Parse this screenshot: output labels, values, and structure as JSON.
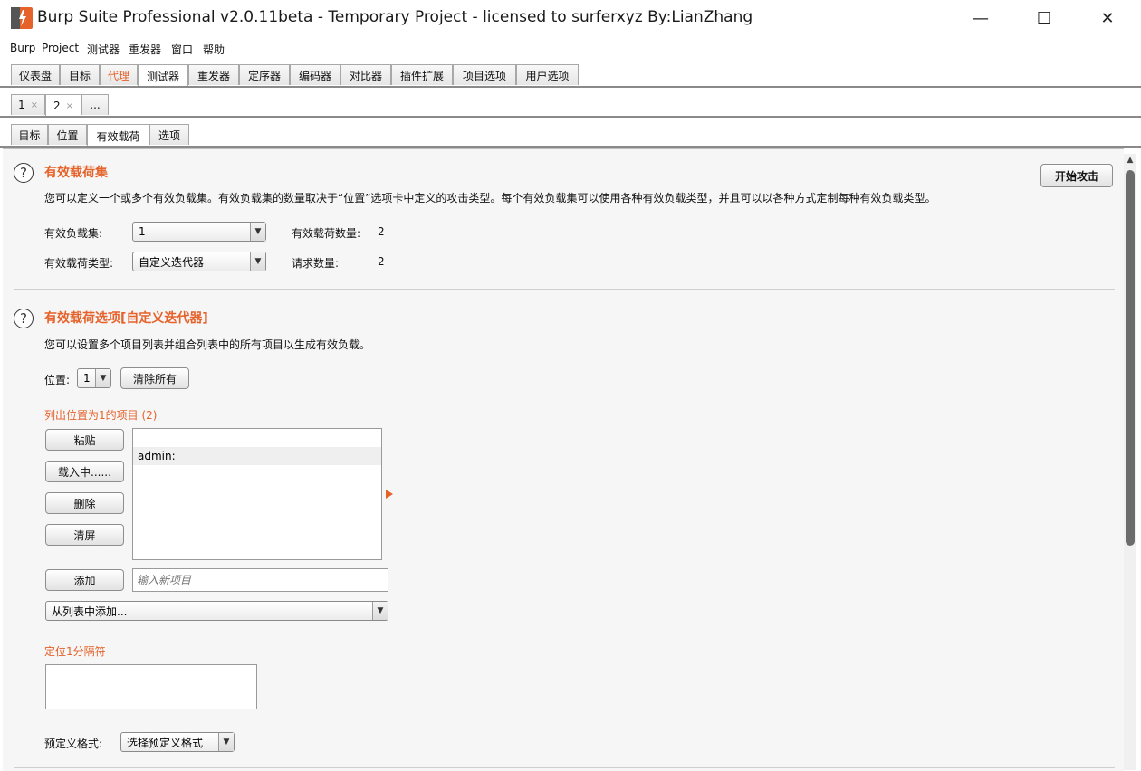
{
  "window": {
    "title": "Burp Suite Professional v2.0.11beta - Temporary Project - licensed to surferxyz By:LianZhang",
    "minimize": "—",
    "maximize": "☐",
    "close": "✕"
  },
  "menu": [
    "Burp",
    "Project",
    "测试器",
    "重发器",
    "窗口",
    "帮助"
  ],
  "main_tabs": [
    {
      "label": "仪表盘"
    },
    {
      "label": "目标"
    },
    {
      "label": "代理"
    },
    {
      "label": "测试器"
    },
    {
      "label": "重发器"
    },
    {
      "label": "定序器"
    },
    {
      "label": "编码器"
    },
    {
      "label": "对比器"
    },
    {
      "label": "插件扩展"
    },
    {
      "label": "项目选项"
    },
    {
      "label": "用户选项"
    }
  ],
  "attack_tabs": [
    {
      "label": "1",
      "close": "×"
    },
    {
      "label": "2",
      "close": "×"
    },
    {
      "label": "..."
    }
  ],
  "sub_tabs": [
    {
      "label": "目标"
    },
    {
      "label": "位置"
    },
    {
      "label": "有效载荷"
    },
    {
      "label": "选项"
    }
  ],
  "payload_sets": {
    "help": "?",
    "title": "有效载荷集",
    "description": "您可以定义一个或多个有效负载集。有效负载集的数量取决于“位置”选项卡中定义的攻击类型。每个有效负载集可以使用各种有效负载类型，并且可以以各种方式定制每种有效负载类型。",
    "start_attack": "开始攻击",
    "set_label": "有效负载集:",
    "set_value": "1",
    "count_label": "有效载荷数量:",
    "count_value": "2",
    "type_label": "有效载荷类型:",
    "type_value": "自定义迭代器",
    "request_label": "请求数量:",
    "request_value": "2"
  },
  "payload_options": {
    "help": "?",
    "title": "有效载荷选项[自定义迭代器]",
    "description": "您可以设置多个项目列表并组合列表中的所有项目以生成有效负载。",
    "position_label": "位置:",
    "position_value": "1",
    "clear_all": "清除所有",
    "list_label": "列出位置为1的项目 (2)",
    "paste": "粘贴",
    "load": "载入中......",
    "remove": "删除",
    "clear": "清屏",
    "items": [
      "",
      "admin:"
    ],
    "add": "添加",
    "add_placeholder": "输入新项目",
    "add_from_list": "从列表中添加...",
    "separator_label": "定位1分隔符",
    "predefined_label": "预定义格式:",
    "predefined_value": "选择预定义格式"
  },
  "colors": {
    "accent": "#e5622a"
  },
  "icons": {
    "app": "burp-logo-icon",
    "arrow": "orange-triangle-icon"
  }
}
